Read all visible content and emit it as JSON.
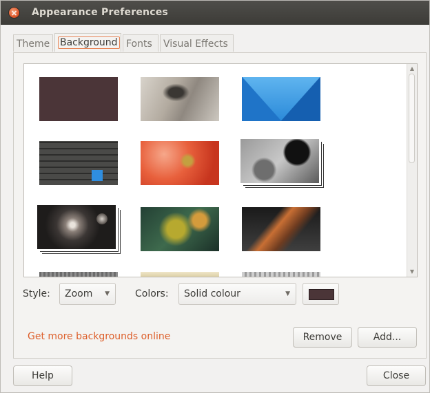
{
  "window": {
    "title": "Appearance Preferences"
  },
  "tabs": [
    {
      "label": "Theme"
    },
    {
      "label": "Background"
    },
    {
      "label": "Fonts"
    },
    {
      "label": "Visual Effects"
    }
  ],
  "wallpapers": [
    "solid-colour",
    "snail",
    "blue-peak",
    "wood-planks",
    "red-flower",
    "gray-water-drop",
    "spiral-galaxy",
    "green-leaf",
    "orange-feather",
    "gray-texture",
    "cream-texture",
    "white-texture"
  ],
  "controls": {
    "style_label": "Style:",
    "style_value": "Zoom",
    "colors_label": "Colors:",
    "colors_value": "Solid colour",
    "swatch_color": "#4b3538"
  },
  "links": {
    "more_backgrounds": "Get more backgrounds online"
  },
  "buttons": {
    "remove": "Remove",
    "add": "Add...",
    "help": "Help",
    "close": "Close"
  }
}
